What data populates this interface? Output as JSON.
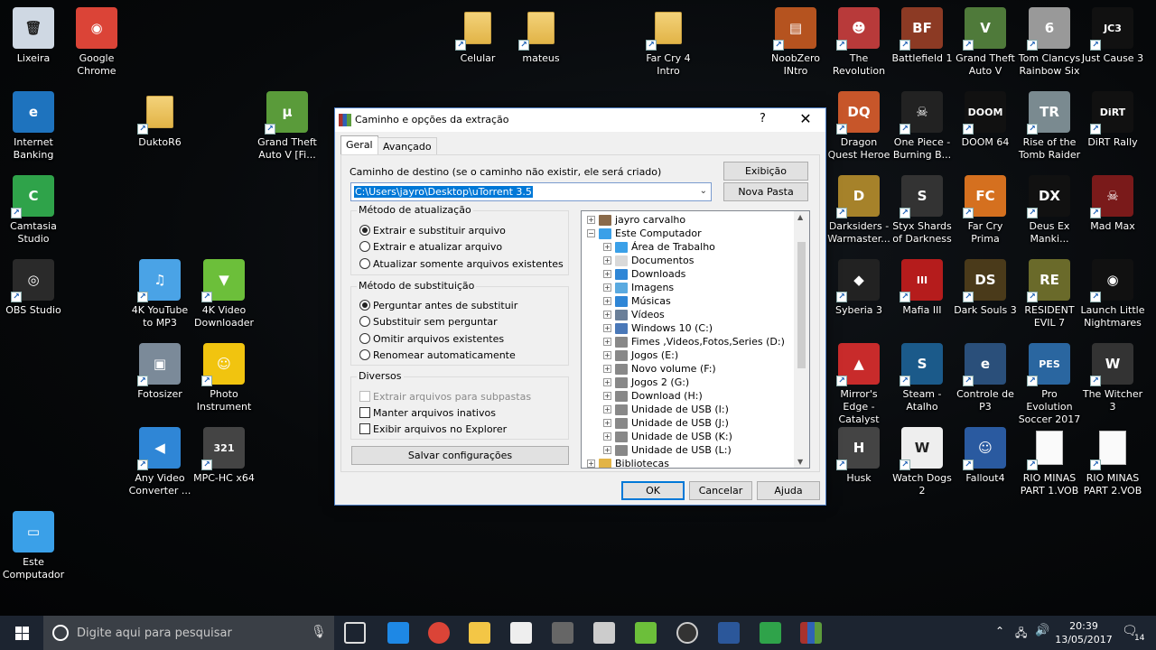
{
  "desktop_icons": [
    {
      "label": "Lixeira",
      "color": "#cfd8e3",
      "glyph": "🗑"
    },
    {
      "label": "Google Chrome",
      "color": "#db4437",
      "glyph": "◉"
    },
    {
      "label": "Internet Banking",
      "color": "#1e73be",
      "glyph": "e"
    },
    {
      "label": "DuktoR6",
      "color": "#f3d27a",
      "glyph": ""
    },
    {
      "label": "Grand Theft Auto V [Fi...",
      "color": "#5a9b3a",
      "glyph": "µ"
    },
    {
      "label": "Camtasia Studio",
      "color": "#2fa34a",
      "glyph": "C"
    },
    {
      "label": "OBS Studio",
      "color": "#2a2a2a",
      "glyph": "◎"
    },
    {
      "label": "4K YouTube to MP3",
      "color": "#4aa3e6",
      "glyph": "♫"
    },
    {
      "label": "4K Video Downloader",
      "color": "#6cbf3a",
      "glyph": "▼"
    },
    {
      "label": "Fotosizer",
      "color": "#7b8a99",
      "glyph": "▣"
    },
    {
      "label": "Photo Instrument",
      "color": "#f1c40f",
      "glyph": "☺"
    },
    {
      "label": "Any Video Converter ...",
      "color": "#2f86d6",
      "glyph": "◀"
    },
    {
      "label": "MPC-HC x64",
      "color": "#444",
      "glyph": "321"
    },
    {
      "label": "Este Computador",
      "color": "#3aa0e8",
      "glyph": "▭"
    },
    {
      "label": "Celular",
      "color": "#f3d27a",
      "glyph": ""
    },
    {
      "label": "mateus",
      "color": "#f3d27a",
      "glyph": ""
    },
    {
      "label": "Far Cry 4 Intro",
      "color": "#f3d27a",
      "glyph": ""
    },
    {
      "label": "NoobZero INtro",
      "color": "#b5531f",
      "glyph": "▤"
    },
    {
      "label": "The Revolution",
      "color": "#b83a3a",
      "glyph": "☻"
    },
    {
      "label": "Battlefield 1",
      "color": "#8c3a24",
      "glyph": "BF"
    },
    {
      "label": "Grand Theft Auto V",
      "color": "#4f7a3a",
      "glyph": "V"
    },
    {
      "label": "Tom Clancys Rainbow Six",
      "color": "#999",
      "glyph": "6"
    },
    {
      "label": "Just Cause 3",
      "color": "#111",
      "glyph": "JC3"
    },
    {
      "label": "Dragon Quest Heroe",
      "color": "#c7562a",
      "glyph": "DQ"
    },
    {
      "label": "One Piece - Burning B...",
      "color": "#222",
      "glyph": "☠"
    },
    {
      "label": "DOOM 64",
      "color": "#111",
      "glyph": "DOOM"
    },
    {
      "label": "Rise of the Tomb Raider",
      "color": "#7a8a90",
      "glyph": "TR"
    },
    {
      "label": "DiRT Rally",
      "color": "#111",
      "glyph": "DiRT"
    },
    {
      "label": "Darksiders - Warmaster...",
      "color": "#a6822a",
      "glyph": "D"
    },
    {
      "label": "Styx Shards of Darkness",
      "color": "#333",
      "glyph": "S"
    },
    {
      "label": "Far Cry Prima",
      "color": "#d5701f",
      "glyph": "FC"
    },
    {
      "label": "Deus Ex Manki...",
      "color": "#111",
      "glyph": "DX"
    },
    {
      "label": "Mad Max",
      "color": "#7a1a1a",
      "glyph": "☠"
    },
    {
      "label": "Syberia 3",
      "color": "#222",
      "glyph": "◆"
    },
    {
      "label": "Mafia III",
      "color": "#b51c1c",
      "glyph": "III"
    },
    {
      "label": "Dark Souls 3",
      "color": "#4a3a1a",
      "glyph": "DS"
    },
    {
      "label": "RESIDENT EVIL 7",
      "color": "#6a6a2a",
      "glyph": "RE"
    },
    {
      "label": "Launch Little Nightmares",
      "color": "#111",
      "glyph": "◉"
    },
    {
      "label": "Mirror's Edge - Catalyst",
      "color": "#c82b2b",
      "glyph": "▲"
    },
    {
      "label": "Steam - Atalho",
      "color": "#1b5a8a",
      "glyph": "S"
    },
    {
      "label": "Controle de P3",
      "color": "#2a4f7a",
      "glyph": "e"
    },
    {
      "label": "Pro Evolution Soccer 2017",
      "color": "#2a66a0",
      "glyph": "PES"
    },
    {
      "label": "The Witcher 3",
      "color": "#333",
      "glyph": "W"
    },
    {
      "label": "Husk",
      "color": "#444",
      "glyph": "H"
    },
    {
      "label": "Watch Dogs 2",
      "color": "#eee",
      "glyph": "W"
    },
    {
      "label": "Fallout4",
      "color": "#2a5aa0",
      "glyph": "☺"
    },
    {
      "label": "RIO MINAS PART 1.VOB",
      "color": "#fafafa",
      "glyph": ""
    },
    {
      "label": "RIO MINAS PART 2.VOB",
      "color": "#fafafa",
      "glyph": ""
    }
  ],
  "dialog": {
    "title": "Caminho e opções da extração",
    "help": "?",
    "close": "✕",
    "tabs": [
      "Geral",
      "Avançado"
    ],
    "dest_label": "Caminho de destino (se o caminho não existir, ele será criado)",
    "dest_value": "C:\\Users\\jayro\\Desktop\\uTorrent 3.5",
    "btn_view": "Exibição",
    "btn_new_folder": "Nova Pasta",
    "update_title": "Método de atualização",
    "update_options": [
      "Extrair e substituir arquivo",
      "Extrair e atualizar arquivo",
      "Atualizar somente arquivos existentes"
    ],
    "overwrite_title": "Método de substituição",
    "overwrite_options": [
      "Perguntar antes de substituir",
      "Substituir sem perguntar",
      "Omitir arquivos existentes",
      "Renomear automaticamente"
    ],
    "misc_title": "Diversos",
    "misc_options": [
      "Extrair arquivos para subpastas",
      "Manter arquivos inativos",
      "Exibir arquivos no Explorer"
    ],
    "save_btn": "Salvar configurações",
    "tree": [
      "jayro carvalho",
      "Este Computador",
      "Área de Trabalho",
      "Documentos",
      "Downloads",
      "Imagens",
      "Músicas",
      "Vídeos",
      "Windows 10 (C:)",
      "Fimes ,Videos,Fotos,Series  (D:)",
      "Jogos  (E:)",
      "Novo volume (F:)",
      "Jogos 2 (G:)",
      "Download  (H:)",
      "Unidade de USB (I:)",
      "Unidade de USB (J:)",
      "Unidade de USB (K:)",
      "Unidade de USB (L:)",
      "Bibliotecas"
    ],
    "ok": "OK",
    "cancel": "Cancelar",
    "help_btn": "Ajuda"
  },
  "taskbar": {
    "search_placeholder": "Digite aqui para pesquisar",
    "time": "20:39",
    "date": "13/05/2017",
    "notif_count": "14"
  }
}
